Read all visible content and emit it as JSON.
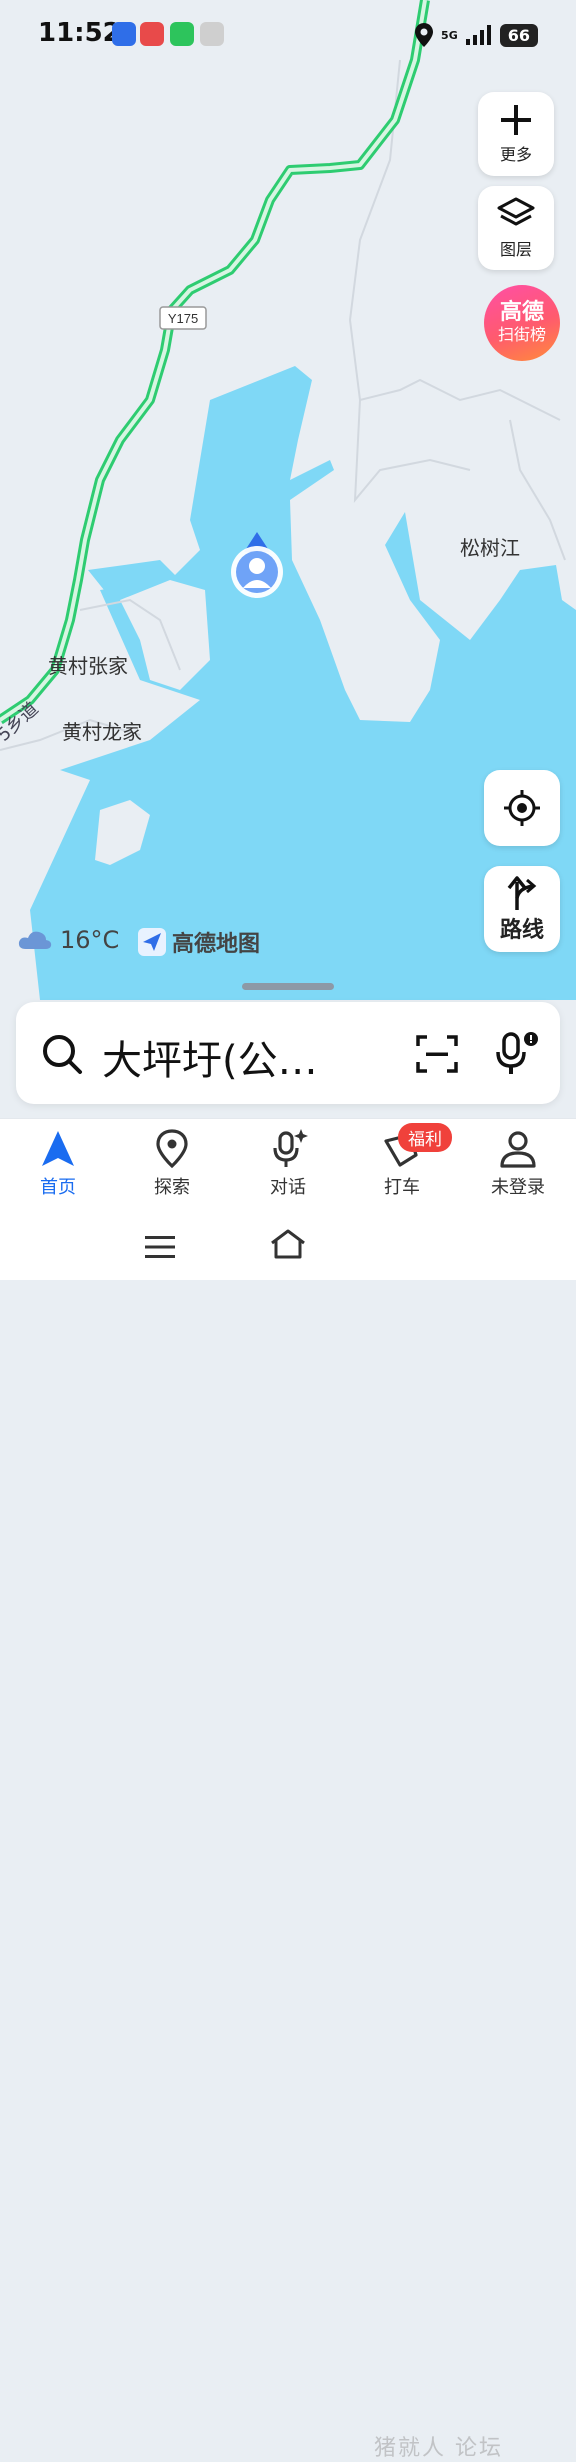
{
  "status_bar": {
    "time": "11:52",
    "network": "5G",
    "battery": "66"
  },
  "map": {
    "water_color": "#7fd8f6",
    "land_color": "#e9eef3",
    "road_color": "#2ecc71",
    "labels": {
      "road_code": "Y175",
      "village_1": "黄村张家",
      "village_2": "黄村龙家",
      "place_east": "松树江",
      "road_name": "5乡道"
    }
  },
  "controls": {
    "more_label": "更多",
    "layers_label": "图层",
    "rank_title": "高德",
    "rank_sub": "扫街榜",
    "route_label": "路线"
  },
  "weather": {
    "temp": "16°C"
  },
  "brand": {
    "name": "高德地图"
  },
  "search": {
    "value": "大坪圩(公…"
  },
  "bottom_nav": {
    "items": [
      {
        "label": "首页"
      },
      {
        "label": "探索"
      },
      {
        "label": "对话"
      },
      {
        "label": "打车"
      },
      {
        "label": "未登录"
      }
    ],
    "badge": "福利",
    "accent": "#1a6cf0"
  },
  "watermark": "猪就人 论坛"
}
